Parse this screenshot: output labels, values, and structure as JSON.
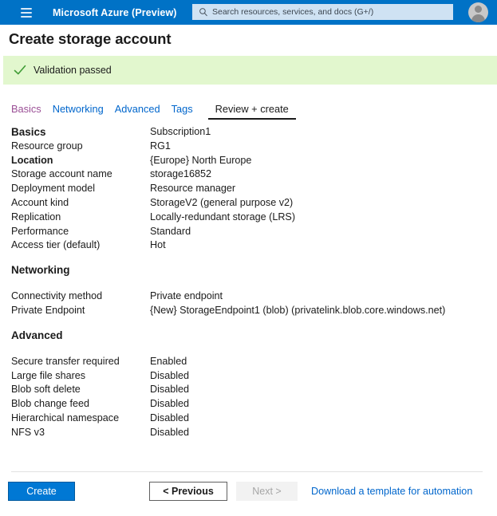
{
  "topbar": {
    "menu_icon": "hamburger-icon",
    "brand": "Microsoft Azure (Preview)",
    "search_icon": "search-icon",
    "search_placeholder": "Search resources, services, and docs (G+/)",
    "avatar_icon": "account-avatar-icon",
    "background_color": "#0072c6"
  },
  "page": {
    "title": "Create storage account"
  },
  "banner": {
    "icon": "check-mark-icon",
    "text": "Validation passed",
    "background_color": "#e2f7ce",
    "icon_color": "#3f9c35"
  },
  "tabs": [
    {
      "label": "Basics",
      "state": "visited"
    },
    {
      "label": "Networking",
      "state": "link"
    },
    {
      "label": "Advanced",
      "state": "link"
    },
    {
      "label": "Tags",
      "state": "link"
    },
    {
      "label": "Review + create",
      "state": "active"
    }
  ],
  "sections": {
    "basics": {
      "heading": "Basics",
      "heading_value": "Subscription1",
      "rows": [
        {
          "key": "Resource group",
          "value": "RG1",
          "bold": false
        },
        {
          "key": "Location",
          "value": "{Europe} North Europe",
          "bold": true
        },
        {
          "key": "Storage account name",
          "value": "storage16852",
          "bold": false
        },
        {
          "key": "Deployment model",
          "value": "Resource manager",
          "bold": false
        },
        {
          "key": "Account kind",
          "value": "StorageV2 (general purpose v2)",
          "bold": false
        },
        {
          "key": "Replication",
          "value": "Locally-redundant storage (LRS)",
          "bold": false
        },
        {
          "key": "Performance",
          "value": "Standard",
          "bold": false
        },
        {
          "key": "Access tier (default)",
          "value": "Hot",
          "bold": false
        }
      ]
    },
    "networking": {
      "heading": "Networking",
      "rows": [
        {
          "key": "Connectivity method",
          "value": "Private endpoint"
        },
        {
          "key": "Private Endpoint",
          "value": "{New} StorageEndpoint1 (blob) (privatelink.blob.core.windows.net)"
        }
      ]
    },
    "advanced": {
      "heading": "Advanced",
      "rows": [
        {
          "key": "Secure transfer required",
          "value": "Enabled"
        },
        {
          "key": "Large file shares",
          "value": "Disabled"
        },
        {
          "key": "Blob soft delete",
          "value": "Disabled"
        },
        {
          "key": "Blob change feed",
          "value": "Disabled"
        },
        {
          "key": "Hierarchical namespace",
          "value": "Disabled"
        },
        {
          "key": "NFS v3",
          "value": "Disabled"
        }
      ]
    }
  },
  "footer": {
    "create_label": "Create",
    "previous_label": "< Previous",
    "next_label": "Next >",
    "download_link_label": "Download a template for automation",
    "primary_color": "#0078d4",
    "link_color": "#0066cc"
  }
}
